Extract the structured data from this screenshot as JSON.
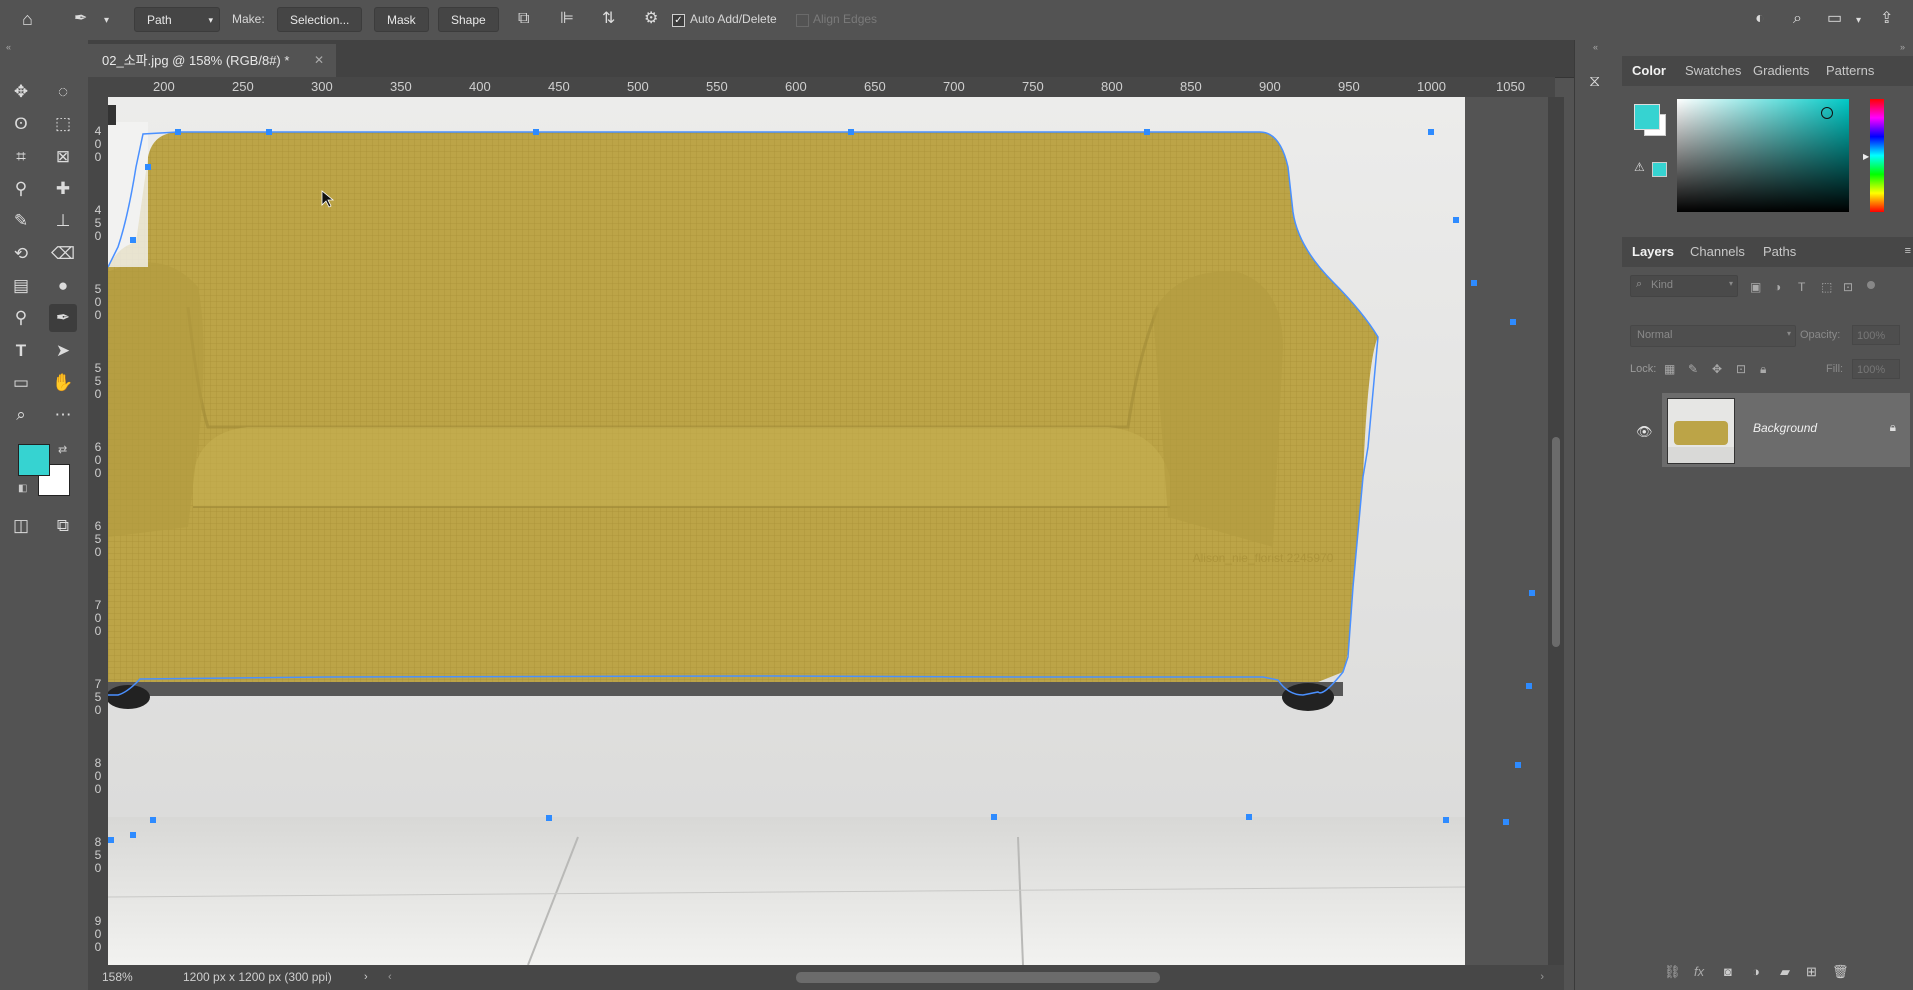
{
  "options_bar": {
    "tool_mode": "Path",
    "make_label": "Make:",
    "selection_button": "Selection...",
    "mask_button": "Mask",
    "shape_button": "Shape",
    "auto_add_delete": "Auto Add/Delete",
    "auto_add_delete_checked": true,
    "align_edges": "Align Edges"
  },
  "document": {
    "tab_title": "02_소파.jpg @ 158% (RGB/8#) *",
    "zoom": "158%",
    "doc_info": "1200 px x 1200 px (300 ppi)",
    "watermark": "Alison_nie_florist 2245970"
  },
  "rulers": {
    "horizontal": [
      "200",
      "250",
      "300",
      "350",
      "400",
      "450",
      "500",
      "550",
      "600",
      "650",
      "700",
      "750",
      "800",
      "850",
      "900",
      "950",
      "1000",
      "1050"
    ],
    "vertical": [
      "4\n0\n0",
      "4\n5\n0",
      "5\n0\n0",
      "5\n5\n0",
      "6\n0\n0",
      "6\n5\n0",
      "7\n0\n0",
      "7\n5\n0",
      "8\n0\n0",
      "8\n5\n0",
      "9\n0\n0"
    ]
  },
  "colors": {
    "foreground": "#36d3d1",
    "background": "#ffffff",
    "sofa": "#bca447",
    "path_point": "#2e8bff"
  },
  "color_panel": {
    "tabs": [
      "Color",
      "Swatches",
      "Gradients",
      "Patterns"
    ]
  },
  "layers_panel": {
    "tabs": [
      "Layers",
      "Channels",
      "Paths"
    ],
    "filter_placeholder": "Kind",
    "blend_mode": "Normal",
    "opacity_label": "Opacity:",
    "opacity_value": "100%",
    "lock_label": "Lock:",
    "fill_label": "Fill:",
    "fill_value": "100%",
    "layers": [
      {
        "name": "Background",
        "visible": true,
        "locked": true
      }
    ]
  }
}
